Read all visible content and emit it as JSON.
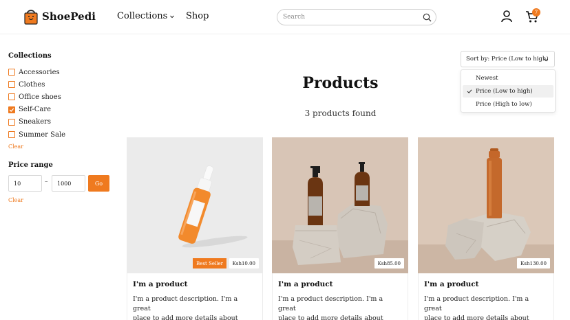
{
  "brand": {
    "name": "ShoePedi",
    "accent": "#ef7a1f"
  },
  "nav": {
    "collections": "Collections",
    "shop": "Shop"
  },
  "search": {
    "placeholder": "Search"
  },
  "cart": {
    "count": "7"
  },
  "filters": {
    "collections_title": "Collections",
    "items": [
      {
        "label": "Accessories",
        "checked": false
      },
      {
        "label": "Clothes",
        "checked": false
      },
      {
        "label": "Office shoes",
        "checked": false
      },
      {
        "label": "Self-Care",
        "checked": true
      },
      {
        "label": "Sneakers",
        "checked": false
      },
      {
        "label": "Summer Sale",
        "checked": false
      }
    ],
    "clear": "Clear",
    "price_title": "Price range",
    "price_min": "10",
    "price_dash": "–",
    "price_max": "1000",
    "go": "Go",
    "price_clear": "Clear"
  },
  "main": {
    "title": "Products",
    "results": "3 products found"
  },
  "sort": {
    "label": "Sort by: Price (Low to high)",
    "options": [
      {
        "label": "Newest",
        "selected": false
      },
      {
        "label": "Price (Low to high)",
        "selected": true
      },
      {
        "label": "Price (High to low)",
        "selected": false
      }
    ]
  },
  "products": [
    {
      "title": "I'm a product",
      "price": "Ksh10.00",
      "badge": "Best Seller",
      "desc1": "I'm a product description. I'm a great",
      "desc2": "place to add more details about your..."
    },
    {
      "title": "I'm a product",
      "price": "Ksh85.00",
      "badge": "",
      "desc1": "I'm a product description. I'm a great",
      "desc2": "place to add more details about your..."
    },
    {
      "title": "I'm a product",
      "price": "Ksh130.00",
      "badge": "",
      "desc1": "I'm a product description. I'm a great",
      "desc2": "place to add more details about your..."
    }
  ]
}
